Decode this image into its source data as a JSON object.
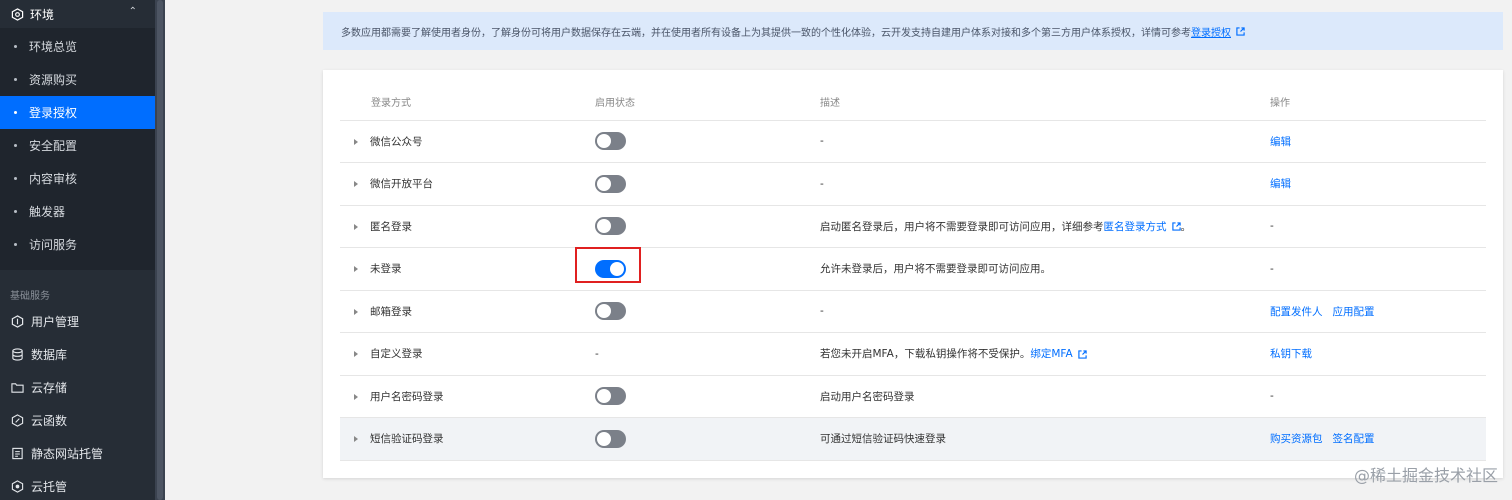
{
  "sidebar": {
    "env_title": "环境",
    "sub_items": [
      {
        "label": "环境总览",
        "active": false
      },
      {
        "label": "资源购买",
        "active": false
      },
      {
        "label": "登录授权",
        "active": true
      },
      {
        "label": "安全配置",
        "active": false
      },
      {
        "label": "内容审核",
        "active": false
      },
      {
        "label": "触发器",
        "active": false
      },
      {
        "label": "访问服务",
        "active": false
      }
    ],
    "section_label": "基础服务",
    "nav_items": [
      {
        "label": "用户管理",
        "icon": "hexagon-icon"
      },
      {
        "label": "数据库",
        "icon": "database-icon"
      },
      {
        "label": "云存储",
        "icon": "folder-icon"
      },
      {
        "label": "云函数",
        "icon": "function-icon"
      },
      {
        "label": "静态网站托管",
        "icon": "document-icon"
      },
      {
        "label": "云托管",
        "icon": "container-icon"
      }
    ]
  },
  "banner": {
    "text": "多数应用都需要了解使用者身份，了解身份可将用户数据保存在云端，并在使用者所有设备上为其提供一致的个性化体验，云开发支持自建用户体系对接和多个第三方用户体系授权，详情可参考",
    "link": "登录授权"
  },
  "table": {
    "headers": [
      "登录方式",
      "启用状态",
      "描述",
      "操作"
    ],
    "rows": [
      {
        "name": "微信公众号",
        "toggle": "off",
        "desc": "-",
        "desc_link": "",
        "desc_tail": "",
        "ops": [
          "编辑"
        ],
        "ops_plain": ""
      },
      {
        "name": "微信开放平台",
        "toggle": "off",
        "desc": "-",
        "desc_link": "",
        "desc_tail": "",
        "ops": [
          "编辑"
        ],
        "ops_plain": ""
      },
      {
        "name": "匿名登录",
        "toggle": "off",
        "desc": "启动匿名登录后，用户将不需要登录即可访问应用，详细参考",
        "desc_link": "匿名登录方式",
        "desc_tail": "。",
        "ops": [],
        "ops_plain": "-"
      },
      {
        "name": "未登录",
        "toggle": "on",
        "desc": "允许未登录后，用户将不需要登录即可访问应用。",
        "desc_link": "",
        "desc_tail": "",
        "ops": [],
        "ops_plain": "-"
      },
      {
        "name": "邮箱登录",
        "toggle": "off",
        "desc": "-",
        "desc_link": "",
        "desc_tail": "",
        "ops": [
          "配置发件人",
          "应用配置"
        ],
        "ops_plain": ""
      },
      {
        "name": "自定义登录",
        "toggle": "none",
        "state_text": "-",
        "desc": "若您未开启MFA，下载私钥操作将不受保护。",
        "desc_link": "绑定MFA",
        "desc_tail": "",
        "ops": [
          "私钥下载"
        ],
        "ops_plain": ""
      },
      {
        "name": "用户名密码登录",
        "toggle": "off",
        "desc": "启动用户名密码登录",
        "desc_link": "",
        "desc_tail": "",
        "ops": [],
        "ops_plain": "-"
      },
      {
        "name": "短信验证码登录",
        "toggle": "off",
        "desc": "可通过短信验证码快速登录",
        "desc_link": "",
        "desc_tail": "",
        "ops": [
          "购买资源包",
          "签名配置"
        ],
        "ops_plain": ""
      }
    ]
  },
  "watermark": "@稀土掘金技术社区",
  "colors": {
    "accent": "#006eff",
    "sidebar_bg": "#262d36",
    "highlight_border": "#e02020"
  }
}
